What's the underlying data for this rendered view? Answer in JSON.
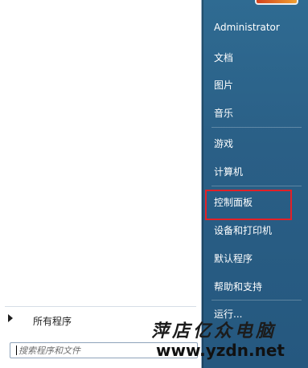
{
  "left_pane": {
    "all_programs_label": "所有程序",
    "search_placeholder": "搜索程序和文件"
  },
  "right_pane": {
    "items": [
      {
        "label": "Administrator"
      },
      {
        "label": "文档"
      },
      {
        "label": "图片"
      },
      {
        "label": "音乐"
      },
      {
        "label": "游戏"
      },
      {
        "label": "计算机"
      },
      {
        "label": "控制面板"
      },
      {
        "label": "设备和打印机"
      },
      {
        "label": "默认程序"
      },
      {
        "label": "帮助和支持"
      },
      {
        "label": "运行..."
      }
    ]
  },
  "watermark": {
    "title": "萍店亿众电脑",
    "url": "www.yzdn.net"
  },
  "colors": {
    "highlight": "#e32027",
    "right_pane": "#2a5f86"
  }
}
